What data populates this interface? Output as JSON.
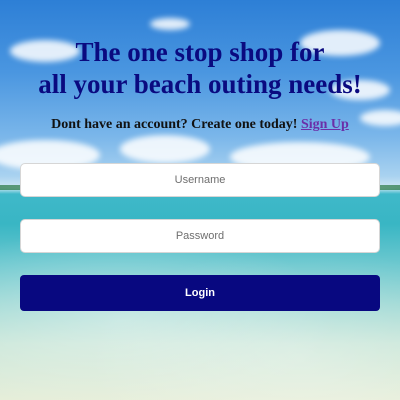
{
  "hero": {
    "headline_line1": "The one stop shop for",
    "headline_line2": "all your beach outing needs!"
  },
  "signup": {
    "prompt": "Dont have an account? Create one today! ",
    "link_label": "Sign Up"
  },
  "login_form": {
    "username_placeholder": "Username",
    "password_placeholder": "Password",
    "submit_label": "Login"
  },
  "colors": {
    "headline": "#0a0a80",
    "button_bg": "#080880",
    "link": "#6b2fa8"
  }
}
